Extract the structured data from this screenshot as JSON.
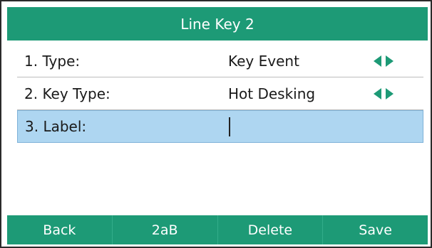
{
  "title": "Line Key 2",
  "colors": {
    "accent": "#1d9a76",
    "selected_row": "#aed6f1"
  },
  "rows": [
    {
      "label": "1. Type:",
      "value": "Key Event",
      "has_arrows": true
    },
    {
      "label": "2. Key Type:",
      "value": "Hot Desking",
      "has_arrows": true
    },
    {
      "label": "3. Label:",
      "value": "",
      "has_arrows": false,
      "selected": true
    }
  ],
  "icons": {
    "left": "triangle-left-icon",
    "right": "triangle-right-icon"
  },
  "softkeys": [
    "Back",
    "2aB",
    "Delete",
    "Save"
  ]
}
